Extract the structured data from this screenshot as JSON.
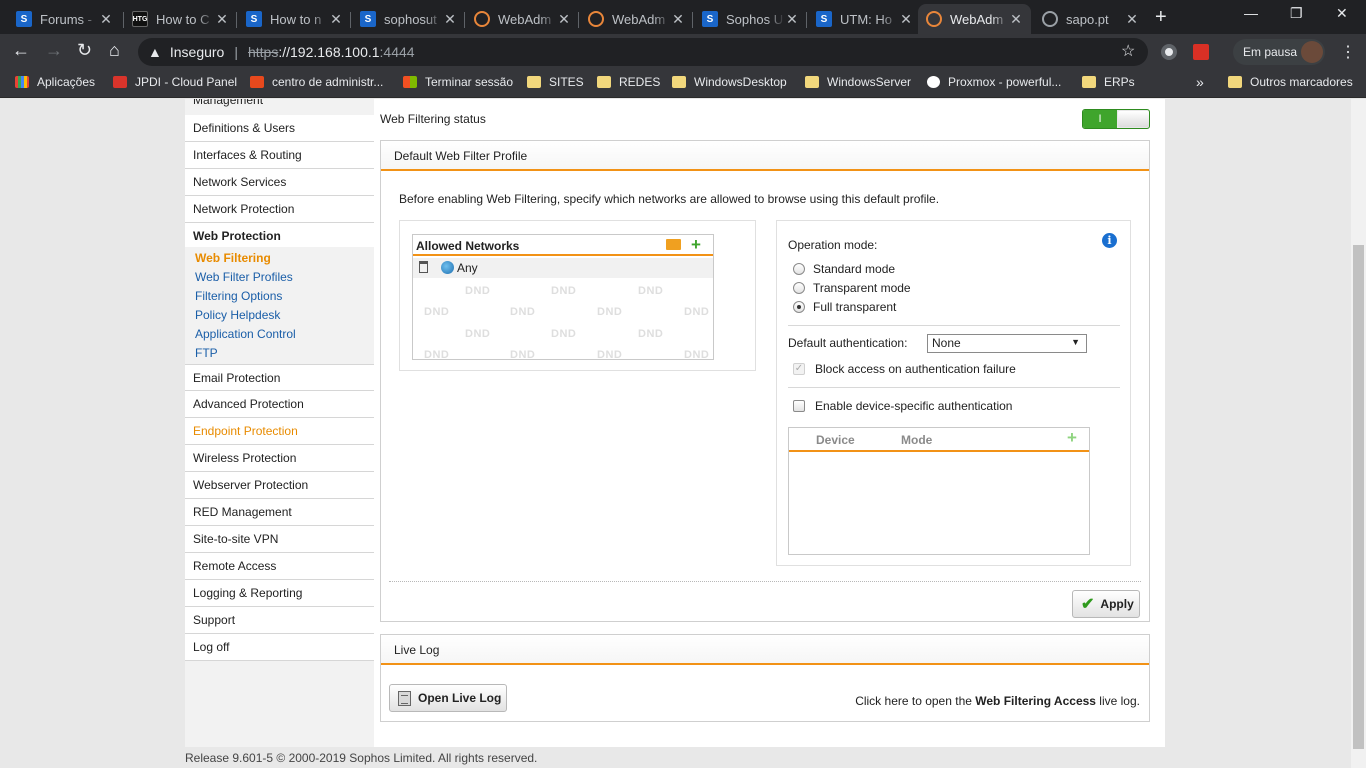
{
  "browser": {
    "tabs": [
      {
        "title": "Forums -",
        "favicon": "sophos-s-icon"
      },
      {
        "title": "How to C",
        "favicon": "htg-icon"
      },
      {
        "title": "How to n",
        "favicon": "sophos-s-icon"
      },
      {
        "title": "sophosut",
        "favicon": "sophos-s-icon"
      },
      {
        "title": "WebAdm",
        "favicon": "webadmin-icon"
      },
      {
        "title": "WebAdm",
        "favicon": "webadmin-icon"
      },
      {
        "title": "Sophos U",
        "favicon": "sophos-s-icon"
      },
      {
        "title": "UTM: Ho",
        "favicon": "sophos-s-icon"
      },
      {
        "title": "WebAdm",
        "favicon": "webadmin-icon",
        "active": true
      },
      {
        "title": "sapo.pt",
        "favicon": "globe-icon"
      }
    ],
    "address": {
      "security_label": "Inseguro",
      "protocol": "https",
      "host": "://192.168.100.1",
      "port": ":4444"
    },
    "profile_label": "Em pausa",
    "bookmarks": [
      {
        "label": "Aplicações",
        "icon": "apps-icon"
      },
      {
        "label": "JPDI - Cloud Panel",
        "icon": "jpdi-icon"
      },
      {
        "label": "centro de administr...",
        "icon": "office-icon"
      },
      {
        "label": "Terminar sessão",
        "icon": "microsoft-icon"
      },
      {
        "label": "SITES",
        "icon": "folder-icon"
      },
      {
        "label": "REDES",
        "icon": "folder-icon"
      },
      {
        "label": "WindowsDesktop",
        "icon": "folder-icon"
      },
      {
        "label": "WindowsServer",
        "icon": "folder-icon"
      },
      {
        "label": "Proxmox - powerful...",
        "icon": "proxmox-icon"
      },
      {
        "label": "ERPs",
        "icon": "folder-icon"
      }
    ],
    "other_bookmarks": "Outros marcadores"
  },
  "sidebar": {
    "cut_item": "Management",
    "items": [
      "Definitions & Users",
      "Interfaces & Routing",
      "Network Services",
      "Network Protection",
      "Web Protection",
      "Email Protection",
      "Advanced Protection",
      "Endpoint Protection",
      "Wireless Protection",
      "Webserver Protection",
      "RED Management",
      "Site-to-site VPN",
      "Remote Access",
      "Logging & Reporting",
      "Support",
      "Log off"
    ],
    "subitems": [
      "Web Filtering",
      "Web Filter Profiles",
      "Filtering Options",
      "Policy Helpdesk",
      "Application Control",
      "FTP"
    ]
  },
  "main": {
    "status_label": "Web Filtering status",
    "toggle_on": "I",
    "profile": {
      "title": "Default Web Filter Profile",
      "intro": "Before enabling Web Filtering, specify which networks are allowed to browse using this default profile.",
      "networks_title": "Allowed Networks",
      "networks": [
        "Any"
      ],
      "dnd_label": "DND",
      "operation_mode_label": "Operation mode:",
      "modes": [
        {
          "label": "Standard mode",
          "checked": false
        },
        {
          "label": "Transparent mode",
          "checked": false
        },
        {
          "label": "Full transparent",
          "checked": true
        }
      ],
      "default_auth_label": "Default authentication:",
      "default_auth_value": "None",
      "block_access_label": "Block access on authentication failure",
      "device_auth_label": "Enable device-specific authentication",
      "device_columns": [
        "Device",
        "Mode"
      ],
      "apply_label": "Apply"
    },
    "livelog": {
      "title": "Live Log",
      "button_label": "Open Live Log",
      "text_prefix": "Click here to open the ",
      "text_bold": "Web Filtering Access",
      "text_suffix": " live log."
    }
  },
  "footer": "Release 9.601-5  © 2000-2019 Sophos Limited. All rights reserved.",
  "colors": {
    "accent": "#f29216",
    "link": "#1a5ea8",
    "active_nav": "#e88b00",
    "toggle_on": "#3fa52c"
  }
}
